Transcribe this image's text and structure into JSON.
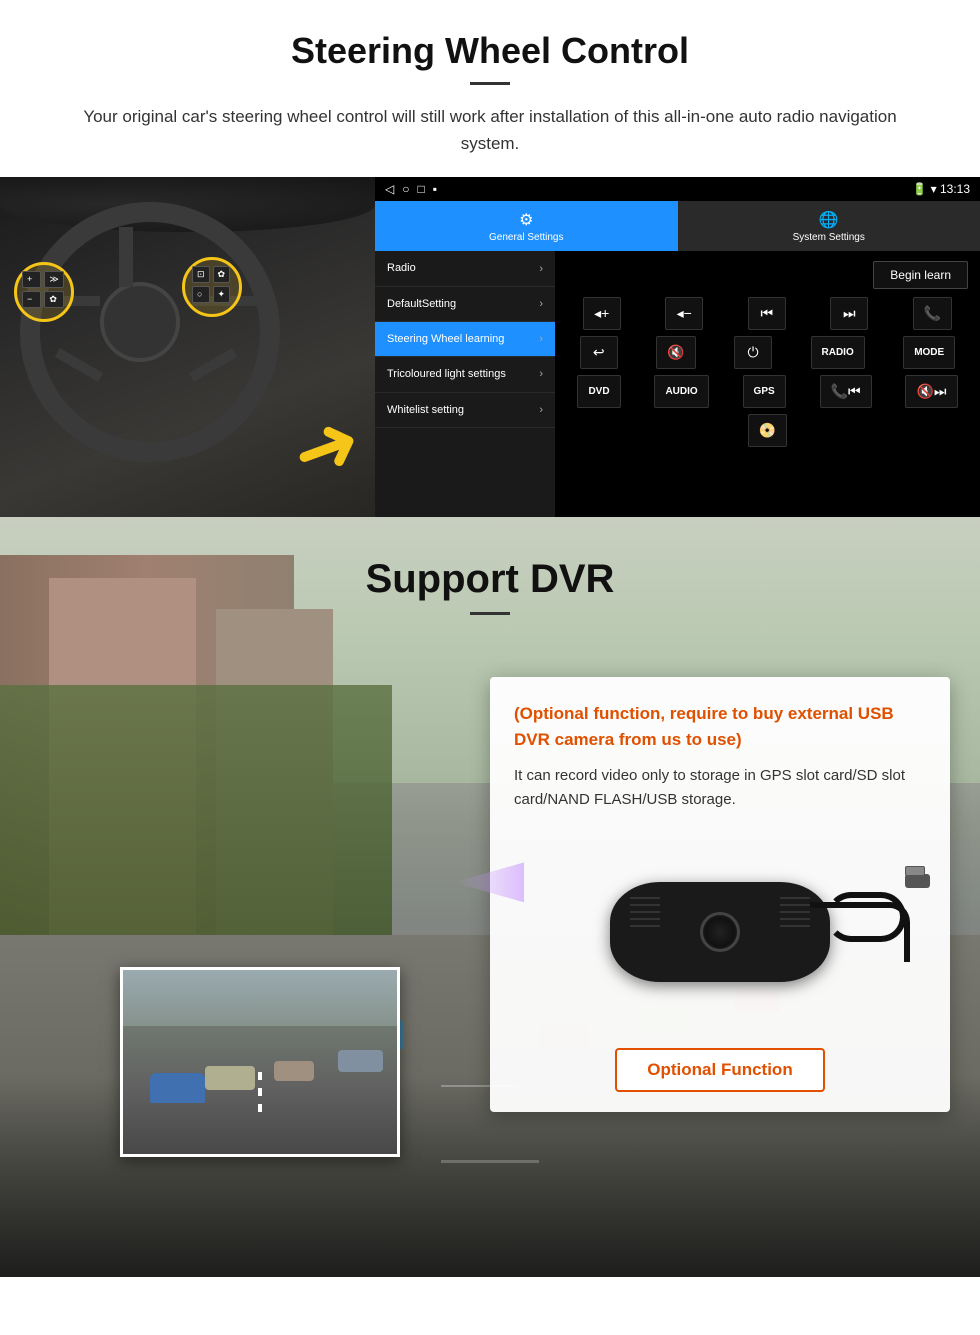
{
  "page": {
    "title": "Steering Wheel Control",
    "subtitle": "Your original car's steering wheel control will still work after installation of this all-in-one auto radio navigation system.",
    "section2_title": "Support DVR"
  },
  "steering": {
    "status_time": "13:13",
    "tabs": {
      "general": "General Settings",
      "system": "System Settings"
    },
    "menu_items": [
      {
        "label": "Radio",
        "active": false
      },
      {
        "label": "DefaultSetting",
        "active": false
      },
      {
        "label": "Steering Wheel learning",
        "active": true
      },
      {
        "label": "Tricoloured light settings",
        "active": false
      },
      {
        "label": "Whitelist setting",
        "active": false
      }
    ],
    "begin_learn": "Begin learn",
    "control_buttons": [
      [
        "vol+",
        "vol-",
        "prev",
        "next",
        "phone"
      ],
      [
        "back",
        "mute",
        "power",
        "RADIO",
        "MODE"
      ],
      [
        "DVD",
        "AUDIO",
        "GPS",
        "tel+prev",
        "mute+next"
      ],
      [
        "dvd-icon"
      ]
    ]
  },
  "dvr": {
    "optional_text": "(Optional function, require to buy external USB DVR camera from us to use)",
    "description": "It can record video only to storage in GPS slot card/SD slot card/NAND FLASH/USB storage.",
    "optional_button": "Optional Function"
  }
}
